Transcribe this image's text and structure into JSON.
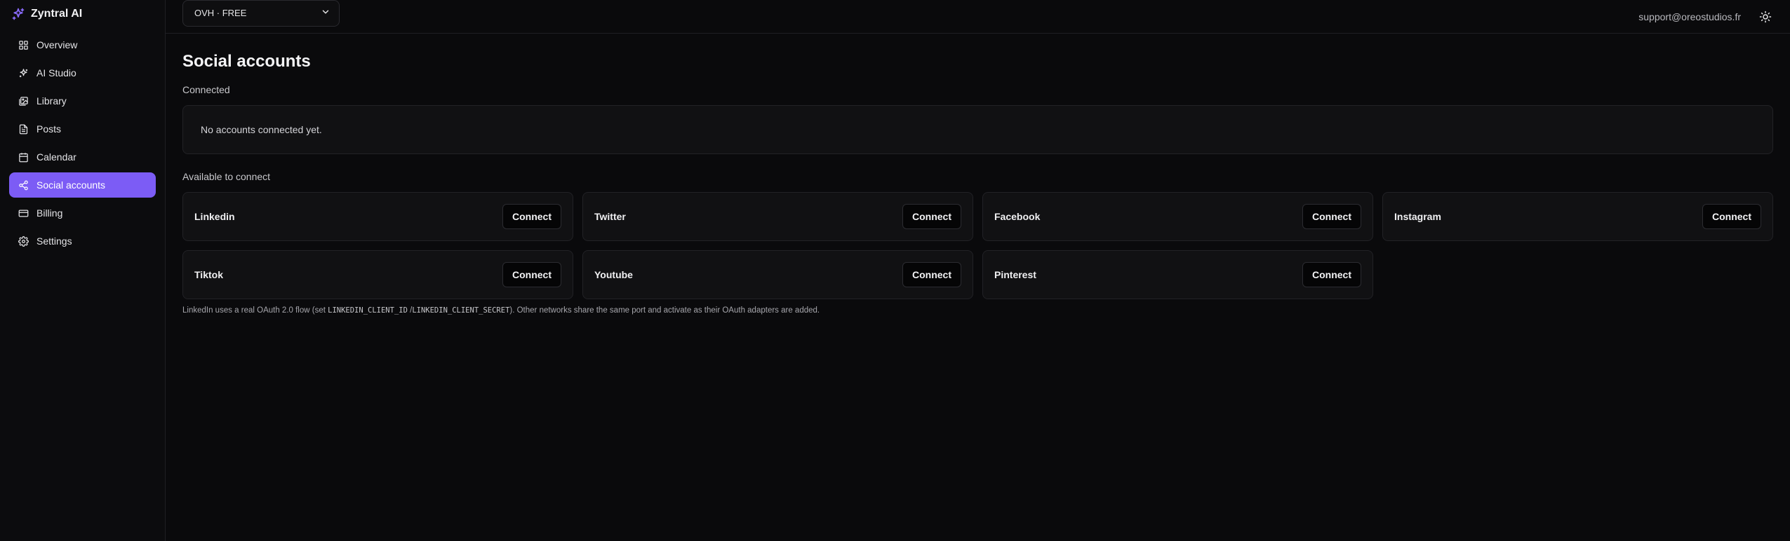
{
  "brand": {
    "name": "Zyntral AI",
    "accent": "#7c5cf5"
  },
  "sidebar": {
    "items": [
      {
        "label": "Overview",
        "icon": "grid-icon"
      },
      {
        "label": "AI Studio",
        "icon": "sparkles-icon"
      },
      {
        "label": "Library",
        "icon": "images-icon"
      },
      {
        "label": "Posts",
        "icon": "file-text-icon"
      },
      {
        "label": "Calendar",
        "icon": "calendar-icon"
      },
      {
        "label": "Social accounts",
        "icon": "share-icon",
        "active": true
      },
      {
        "label": "Billing",
        "icon": "credit-card-icon"
      },
      {
        "label": "Settings",
        "icon": "gear-icon"
      }
    ]
  },
  "topbar": {
    "workspace": "OVH · FREE",
    "email": "support@oreostudios.fr",
    "theme_icon": "sun-icon"
  },
  "page": {
    "title": "Social accounts",
    "connected_label": "Connected",
    "empty_text": "No accounts connected yet.",
    "available_label": "Available to connect",
    "connect_label": "Connect",
    "providers": [
      "Linkedin",
      "Twitter",
      "Facebook",
      "Instagram",
      "Tiktok",
      "Youtube",
      "Pinterest"
    ],
    "footnote": {
      "part1": "LinkedIn uses a real OAuth 2.0 flow (set ",
      "code1": "LINKEDIN_CLIENT_ID",
      "sep": " /",
      "code2": "LINKEDIN_CLIENT_SECRET",
      "part2": "). Other networks share the same port and activate as their OAuth adapters are added."
    }
  }
}
